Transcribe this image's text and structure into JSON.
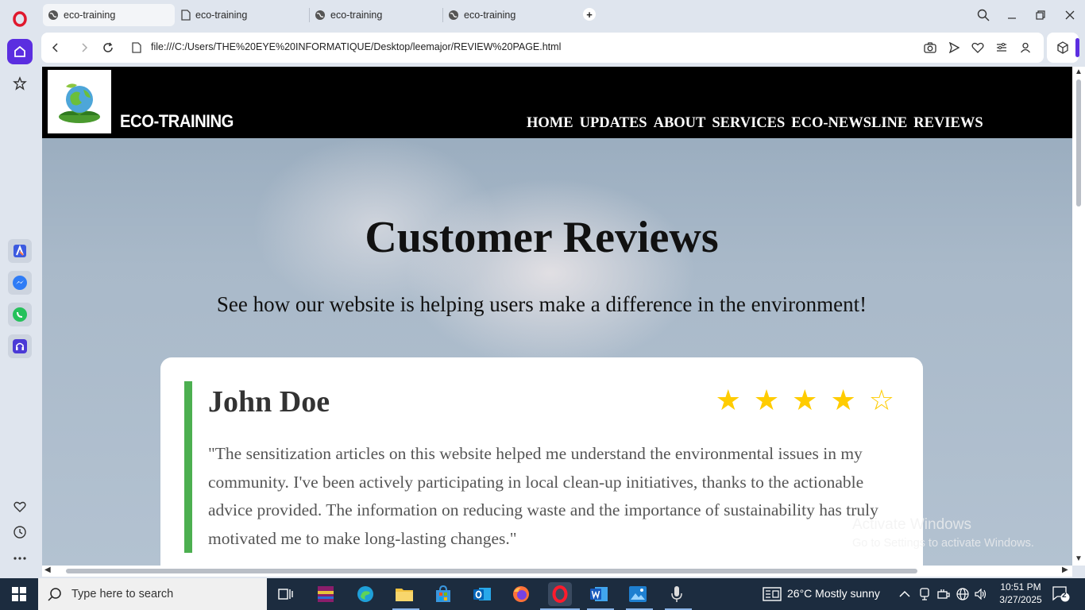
{
  "browser": {
    "tabs": [
      {
        "label": "eco-training",
        "active": true
      },
      {
        "label": "eco-training",
        "active": false
      },
      {
        "label": "eco-training",
        "active": false
      },
      {
        "label": "eco-training",
        "active": false
      }
    ],
    "new_tab_label": "+",
    "url": "file:///C:/Users/THE%20EYE%20INFORMATIQUE/Desktop/leemajor/REVIEW%20PAGE.html"
  },
  "sidebar": {
    "icons": [
      "opera-logo-icon",
      "home-icon",
      "star-icon",
      "aria-icon",
      "messenger-icon",
      "whatsapp-icon",
      "music-player-icon",
      "heart-icon",
      "history-icon",
      "more-icon"
    ]
  },
  "site": {
    "brand": "ECO-TRAINING",
    "nav": [
      {
        "label": "HOME"
      },
      {
        "label": "UPDATES"
      },
      {
        "label": "ABOUT"
      },
      {
        "label": "SERVICES"
      },
      {
        "label": "ECO-NEWSLINE"
      },
      {
        "label": "REVIEWS"
      }
    ],
    "title": "Customer Reviews",
    "subtitle": "See how our website is helping users make a difference in the environment!",
    "review": {
      "name": "John Doe",
      "rating": 4,
      "max_rating": 5,
      "text": "\"The sensitization articles on this website helped me understand the environmental issues in my community. I've been actively participating in local clean-up initiatives, thanks to the actionable advice provided. The information on reducing waste and the importance of sustainability has truly motivated me to make long-lasting changes.\""
    },
    "colors": {
      "header_bg": "#000000",
      "accent_bar": "#4caf50",
      "star": "#ffcc00"
    }
  },
  "watermark": {
    "line1": "Activate Windows",
    "line2": "Go to Settings to activate Windows."
  },
  "taskbar": {
    "search_placeholder": "Type here to search",
    "weather": "26°C  Mostly sunny",
    "time": "10:51 PM",
    "date": "3/27/2025",
    "notification_count": "2"
  }
}
